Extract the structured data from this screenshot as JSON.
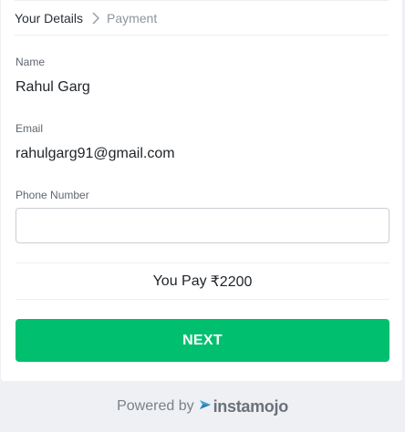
{
  "stepper": {
    "step1": "Your Details",
    "step2": "Payment"
  },
  "form": {
    "name_label": "Name",
    "name_value": "Rahul Garg",
    "email_label": "Email",
    "email_value": "rahulgarg91@gmail.com",
    "phone_label": "Phone Number",
    "phone_value": "",
    "phone_placeholder": ""
  },
  "payment": {
    "prefix": "You Pay",
    "amount": "₹2200"
  },
  "actions": {
    "next_label": "NEXT"
  },
  "footer": {
    "powered_by": "Powered by",
    "brand": "instamojo"
  },
  "colors": {
    "primary": "#00bf6f",
    "background": "#eef0f3",
    "brand_gray": "#6b717a"
  },
  "icons": {
    "step_separator": "chevron-right-icon",
    "brand_logo": "instamojo-logo-icon"
  }
}
